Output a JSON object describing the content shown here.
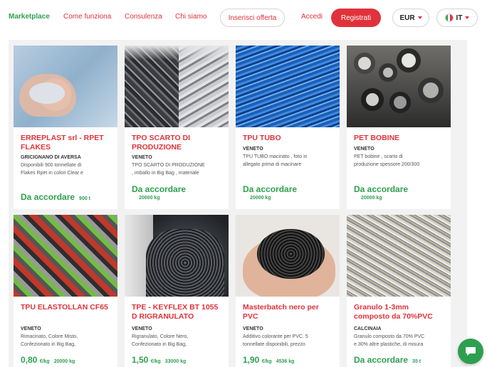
{
  "nav": {
    "brand": "Marketplace",
    "links": [
      "Come funziona",
      "Consulenza",
      "Chi siamo"
    ],
    "insert_offer": "Inserisci offerta",
    "login": "Accedi",
    "register": "Registrati",
    "currency": "EUR",
    "language": "IT",
    "accent_color": "#e0323a",
    "brand_color": "#2e9f4f"
  },
  "listings": [
    {
      "title": "ERREPLAST srl - RPET FLAKES",
      "location": "GRICIGNANO DI AVERSA",
      "desc1": "Disponibili 900 tonnellate di",
      "desc2": "Flakes Rpet in colori Clear e",
      "price": "Da accordare",
      "unit": "",
      "qty": "900 t"
    },
    {
      "title": "TPO SCARTO DI PRODUZIONE",
      "location": "VENETO",
      "desc1": "TPO SCARTO DI PRODUZIONE",
      "desc2": ", imballo in Big Bag , materiale",
      "price": "Da accordare",
      "unit": "",
      "qty": "20000 kg"
    },
    {
      "title": "TPU TUBO",
      "location": "VENETO",
      "desc1": "TPU TUBO macinato , foto in",
      "desc2": "allegato prima di macinare",
      "price": "Da accordare",
      "unit": "",
      "qty": "20000 kg"
    },
    {
      "title": "PET BOBINE",
      "location": "VENETO",
      "desc1": "PET bobine , scarto di",
      "desc2": "produzione spessore 200/300",
      "price": "Da accordare",
      "unit": "",
      "qty": "20000 kg"
    },
    {
      "title": "TPU ELASTOLLAN CF65",
      "location": "VENETO",
      "desc1": "Rimacinato, Colore Misto,",
      "desc2": "Confezionato in Big Bag,",
      "price": "0,80",
      "unit": "€/kg",
      "qty": "20000 kg"
    },
    {
      "title": "TPE - KEYFLEX BT 1055 D RIGRANULATO",
      "location": "VENETO",
      "desc1": "Rigranulato, Colore Nero,",
      "desc2": "Confezionato in Big Bag,",
      "price": "1,50",
      "unit": "€/kg",
      "qty": "33000 kg"
    },
    {
      "title": "Masterbatch nero per PVC",
      "location": "VENETO",
      "desc1": "Additivo colorante per PVC. 5",
      "desc2": "tonnellate disponibili, prezzo",
      "price": "1,90",
      "unit": "€/kg",
      "qty": "4536 kg"
    },
    {
      "title": "Granulo 1-3mm composto da 70%PVC",
      "location": "CALCINAIA",
      "desc1": "Granulo composto da 70% PVC",
      "desc2": "e 30% altre plastiche, di misura",
      "price": "Da accordare",
      "unit": "",
      "qty": "35 t"
    }
  ]
}
